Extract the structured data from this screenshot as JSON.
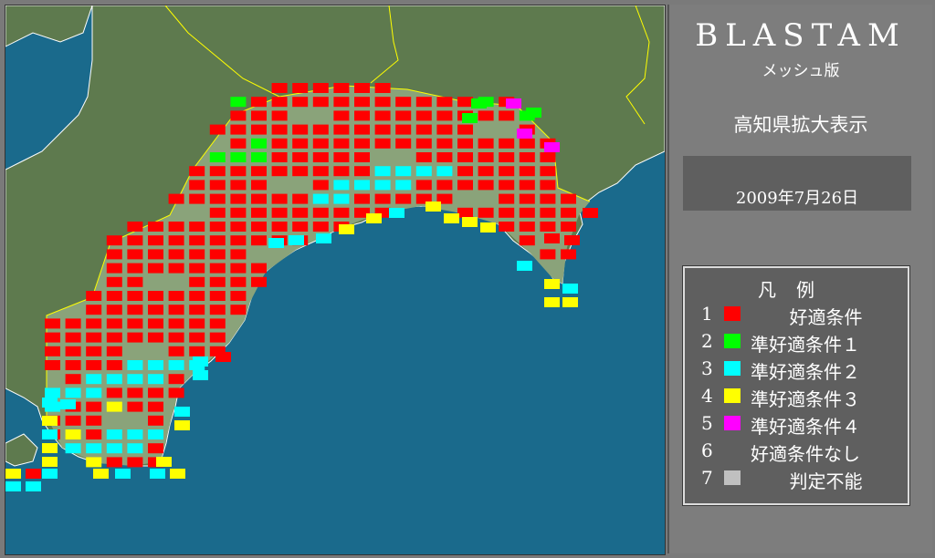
{
  "app": {
    "title": "BLASTAM",
    "subtitle": "メッシュ版"
  },
  "region_label": "高知県拡大表示",
  "date": "2009年7月26日",
  "legend": {
    "title": "凡例",
    "items": [
      {
        "num": "1",
        "label": "好適条件",
        "color": "#ff0000"
      },
      {
        "num": "2",
        "label": "準好適条件１",
        "color": "#00ff00"
      },
      {
        "num": "3",
        "label": "準好適条件２",
        "color": "#00ffff"
      },
      {
        "num": "4",
        "label": "準好適条件３",
        "color": "#ffff00"
      },
      {
        "num": "5",
        "label": "準好適条件４",
        "color": "#ff00ff"
      },
      {
        "num": "6",
        "label": "好適条件なし",
        "color": ""
      },
      {
        "num": "7",
        "label": "判定不能",
        "color": "#c0c0c0"
      }
    ]
  },
  "map": {
    "sea_color": "#1a6a8c",
    "land_color": "#5e7a4e",
    "border_color": "#ffff00"
  }
}
